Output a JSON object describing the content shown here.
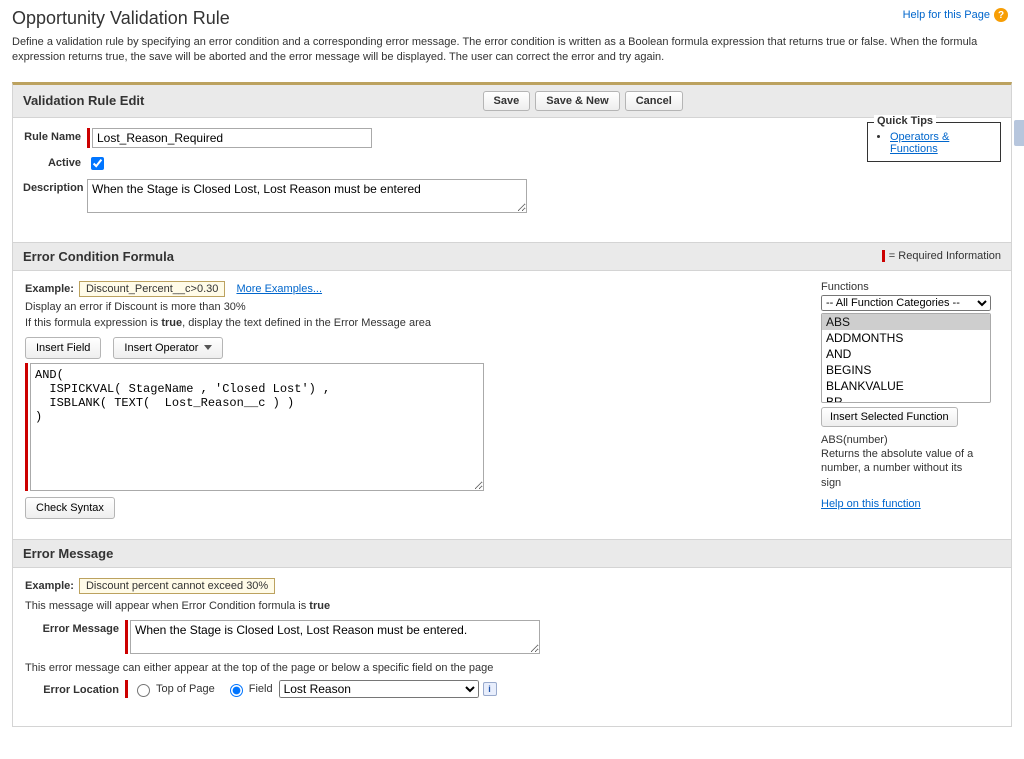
{
  "header": {
    "page_title": "Opportunity Validation Rule",
    "help_link": "Help for this Page",
    "page_description": "Define a validation rule by specifying an error condition and a corresponding error message. The error condition is written as a Boolean formula expression that returns true or false. When the formula expression returns true, the save will be aborted and the error message will be displayed. The user can correct the error and try again."
  },
  "edit_section": {
    "title": "Validation Rule Edit",
    "buttons": {
      "save": "Save",
      "save_new": "Save & New",
      "cancel": "Cancel"
    },
    "fields": {
      "rule_name_label": "Rule Name",
      "rule_name_value": "Lost_Reason_Required",
      "active_label": "Active",
      "active_checked": true,
      "description_label": "Description",
      "description_value": "When the Stage is Closed Lost, Lost Reason must be entered"
    },
    "quick_tips": {
      "legend": "Quick Tips",
      "link": "Operators & Functions"
    }
  },
  "formula_section": {
    "title": "Error Condition Formula",
    "required_info": "= Required Information",
    "example_label": "Example:",
    "example_value": "Discount_Percent__c>0.30",
    "more_examples": "More Examples...",
    "hint1": "Display an error if Discount is more than 30%",
    "hint2_prefix": "If this formula expression is ",
    "hint2_bold": "true",
    "hint2_suffix": ", display the text defined in the Error Message area",
    "insert_field": "Insert Field",
    "insert_operator": "Insert Operator",
    "formula_value": "AND(\n  ISPICKVAL( StageName , 'Closed Lost') ,\n  ISBLANK( TEXT(  Lost_Reason__c ) )\n)",
    "check_syntax": "Check Syntax",
    "functions_label": "Functions",
    "func_category": "-- All Function Categories --",
    "func_list": [
      "ABS",
      "ADDMONTHS",
      "AND",
      "BEGINS",
      "BLANKVALUE",
      "BR"
    ],
    "insert_selected": "Insert Selected Function",
    "func_sig": "ABS(number)",
    "func_desc": "Returns the absolute value of a number, a number without its sign",
    "func_help": "Help on this function"
  },
  "error_section": {
    "title": "Error Message",
    "example_label": "Example:",
    "example_value": "Discount percent cannot exceed 30%",
    "hint_prefix": "This message will appear when Error Condition formula is ",
    "hint_bold": "true",
    "error_message_label": "Error Message",
    "error_message_value": "When the Stage is Closed Lost, Lost Reason must be entered.",
    "location_hint": "This error message can either appear at the top of the page or below a specific field on the page",
    "error_location_label": "Error Location",
    "top_of_page": "Top of Page",
    "field_label": "Field",
    "field_select_value": "Lost Reason"
  }
}
